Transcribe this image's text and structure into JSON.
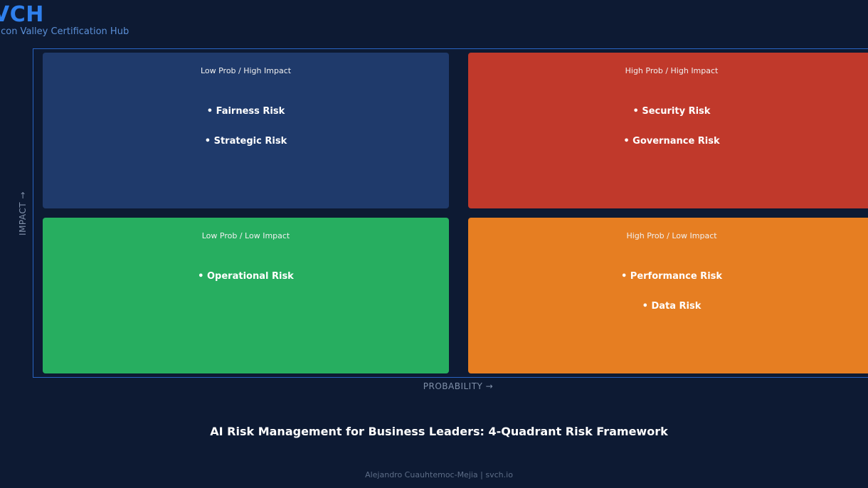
{
  "brand": {
    "logo": "VCH",
    "tagline": "Silicon Valley Certification Hub"
  },
  "axes": {
    "y_label": "IMPACT →",
    "x_label": "PROBABILITY →"
  },
  "quadrants": {
    "top_left": {
      "label": "Low Prob / High Impact",
      "color": "#1f3a6b",
      "items": [
        "• Fairness Risk",
        "• Strategic Risk"
      ]
    },
    "top_right": {
      "label": "High Prob / High Impact",
      "color": "#c0392b",
      "items": [
        "• Security Risk",
        "• Governance Risk"
      ]
    },
    "bottom_left": {
      "label": "Low Prob / Low Impact",
      "color": "#27ae60",
      "items": [
        "• Operational Risk"
      ]
    },
    "bottom_right": {
      "label": "High Prob / Low Impact",
      "color": "#e67e22",
      "items": [
        "• Performance Risk",
        "• Data Risk"
      ]
    }
  },
  "title": "AI Risk Management for Business Leaders: 4-Quadrant Risk Framework",
  "footer": "Alejandro Cuauhtemoc-Mejia  |  svch.io",
  "colors": {
    "background": "#0d1a33",
    "accent": "#2f80ed",
    "frame": "#2a64c2"
  }
}
